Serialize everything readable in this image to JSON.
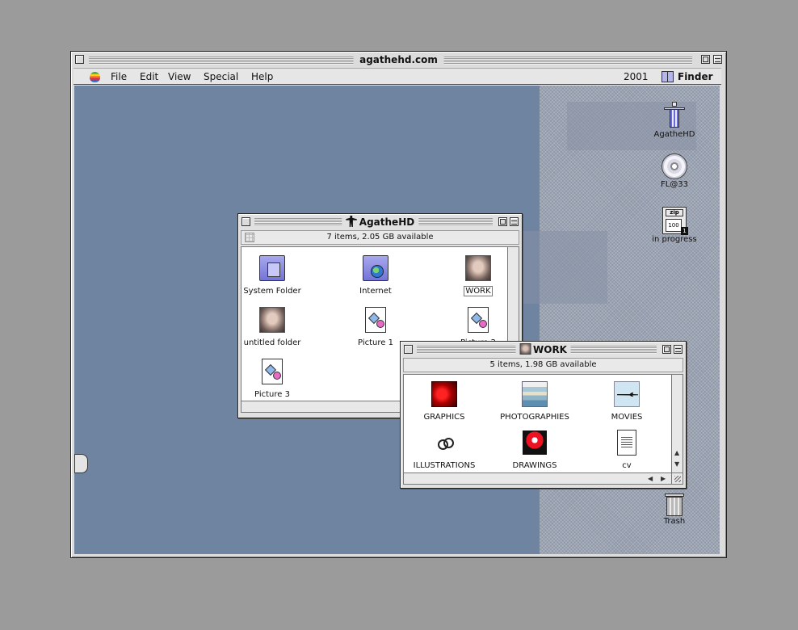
{
  "outer_window": {
    "title": "agathehd.com"
  },
  "menubar": {
    "items": [
      "File",
      "Edit",
      "View",
      "Special",
      "Help"
    ],
    "clock": "2001",
    "app": "Finder"
  },
  "desktop": {
    "icons": [
      {
        "label": "AgatheHD",
        "icon": "hard-drive-figure-icon"
      },
      {
        "label": "FL@33",
        "icon": "cd-icon"
      },
      {
        "label": "in progress",
        "icon": "zip-disk-icon"
      },
      {
        "label": "Trash",
        "icon": "trash-icon"
      }
    ]
  },
  "agathehd_window": {
    "title": "AgatheHD",
    "info": "7 items, 2.05 GB available",
    "items": [
      {
        "label": "System Folder",
        "icon": "system-folder-icon"
      },
      {
        "label": "Internet",
        "icon": "internet-folder-icon"
      },
      {
        "label": "WORK",
        "icon": "face-folder-icon"
      },
      {
        "label": "untitled folder",
        "icon": "face-folder-icon"
      },
      {
        "label": "Picture 1",
        "icon": "picture-file-icon"
      },
      {
        "label": "Picture 2",
        "icon": "picture-file-icon"
      },
      {
        "label": "Picture 3",
        "icon": "picture-file-icon"
      }
    ]
  },
  "work_window": {
    "title": "WORK",
    "info": "5 items, 1.98 GB available",
    "items": [
      {
        "label": "GRAPHICS",
        "icon": "graphics-icon"
      },
      {
        "label": "PHOTOGRAPHIES",
        "icon": "photographies-icon"
      },
      {
        "label": "MOVIES",
        "icon": "movies-icon"
      },
      {
        "label": "ILLUSTRATIONS",
        "icon": "illustrations-icon"
      },
      {
        "label": "DRAWINGS",
        "icon": "drawings-icon"
      },
      {
        "label": "cv",
        "icon": "document-icon"
      }
    ]
  }
}
